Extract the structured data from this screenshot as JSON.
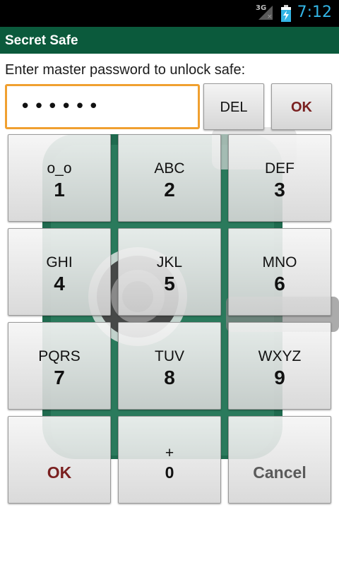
{
  "status_bar": {
    "network": "3G",
    "network_state": "×",
    "time": "7:12",
    "signal_icon": "signal-icon",
    "battery_icon": "battery-charging-icon"
  },
  "app": {
    "title": "Secret Safe"
  },
  "prompt": "Enter master password to unlock safe:",
  "password_field": {
    "value": "••••••"
  },
  "top_buttons": {
    "del": "DEL",
    "ok": "OK"
  },
  "keypad": {
    "keys": [
      {
        "letters": "o_o",
        "digit": "1"
      },
      {
        "letters": "ABC",
        "digit": "2"
      },
      {
        "letters": "DEF",
        "digit": "3"
      },
      {
        "letters": "GHI",
        "digit": "4"
      },
      {
        "letters": "JKL",
        "digit": "5"
      },
      {
        "letters": "MNO",
        "digit": "6"
      },
      {
        "letters": "PQRS",
        "digit": "7"
      },
      {
        "letters": "TUV",
        "digit": "8"
      },
      {
        "letters": "WXYZ",
        "digit": "9"
      }
    ],
    "ok": "OK",
    "zero_top": "+",
    "zero": "0",
    "cancel": "Cancel"
  },
  "colors": {
    "action_bar": "#0b5a3c",
    "safe_green": "#1f6b4f",
    "field_focus": "#f0a030",
    "ok_text": "#7a2020",
    "cancel_text": "#5a5a5a",
    "clock": "#33b5e5"
  }
}
